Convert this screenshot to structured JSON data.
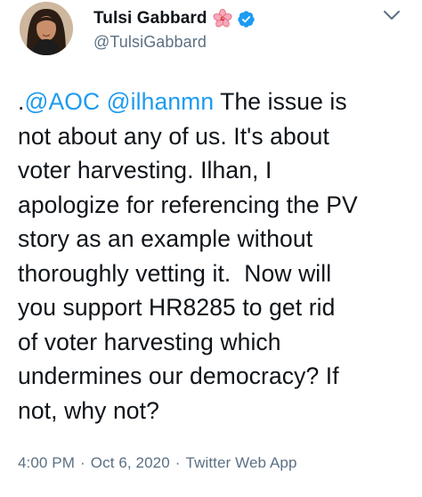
{
  "tweet": {
    "author": {
      "display_name": "Tulsi Gabbard",
      "handle": "@TulsiGabbard",
      "badge_icons": [
        "hibiscus-flower-icon",
        "verified-badge-icon"
      ]
    },
    "menu_icon": "chevron-down-icon",
    "text": {
      "prefix": ".",
      "mention_1": "@AOC",
      "mention_2": "@ilhanmn",
      "line_1_rest": " The issue is",
      "lines": [
        "not about any of us. It's about",
        "voter harvesting. Ilhan, I",
        "apologize for referencing the PV",
        "story as an example without",
        "thoroughly vetting it.  Now will",
        "you support HR8285 to get rid",
        "of voter harvesting which",
        "undermines our democracy? If",
        "not, why not?"
      ]
    },
    "meta": {
      "time": "4:00 PM",
      "separator": "·",
      "date": "Oct 6, 2020",
      "source": "Twitter Web App"
    },
    "colors": {
      "link": "#1d9bf0",
      "secondary_text": "#5b7083",
      "verified": "#1d9bf0",
      "primary_text": "#0f1419"
    }
  }
}
